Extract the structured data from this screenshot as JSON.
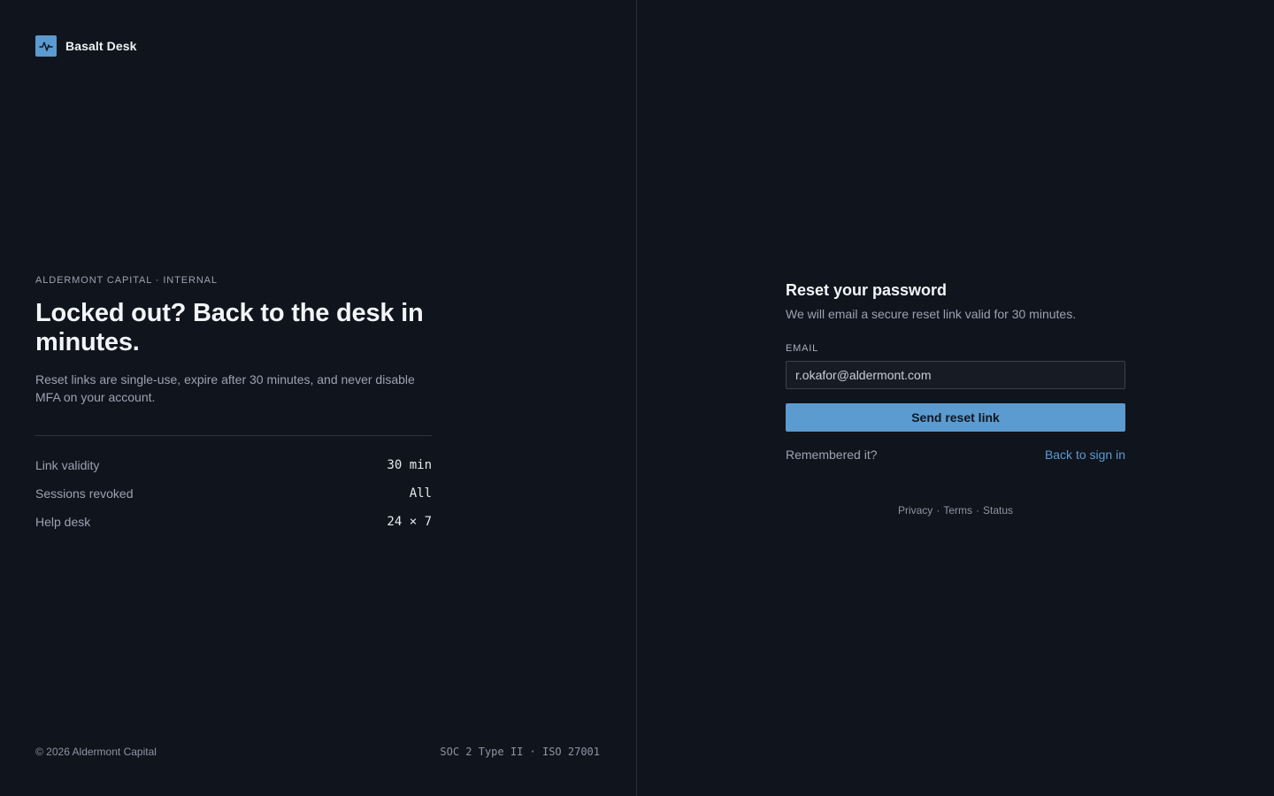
{
  "brand": {
    "name": "Basalt Desk",
    "icon": "activity-pulse-icon",
    "accent": "#5b9bd0"
  },
  "hero": {
    "eyebrow": "ALDERMONT CAPITAL · INTERNAL",
    "headline": "Locked out? Back to the desk in minutes.",
    "lede": "Reset links are single-use, expire after 30 minutes, and never disable MFA on your account.",
    "stats": [
      {
        "label": "Link validity",
        "value": "30 min"
      },
      {
        "label": "Sessions revoked",
        "value": "All"
      },
      {
        "label": "Help desk",
        "value": "24 × 7"
      }
    ]
  },
  "footer_left": {
    "copyright": "© 2026 Aldermont Capital",
    "compliance": "SOC 2 Type II · ISO 27001"
  },
  "reset": {
    "title": "Reset your password",
    "subtitle": "We will email a secure reset link valid for 30 minutes.",
    "email_label": "EMAIL",
    "email_value": "r.okafor@aldermont.com",
    "submit_label": "Send reset link",
    "remembered_text": "Remembered it?",
    "back_link": "Back to sign in"
  },
  "legal": {
    "links": [
      "Privacy",
      "Terms",
      "Status"
    ],
    "separator": "·"
  },
  "colors": {
    "background": "#10141c",
    "accent": "#5b9bd0",
    "muted_text": "#9aa3b2"
  }
}
